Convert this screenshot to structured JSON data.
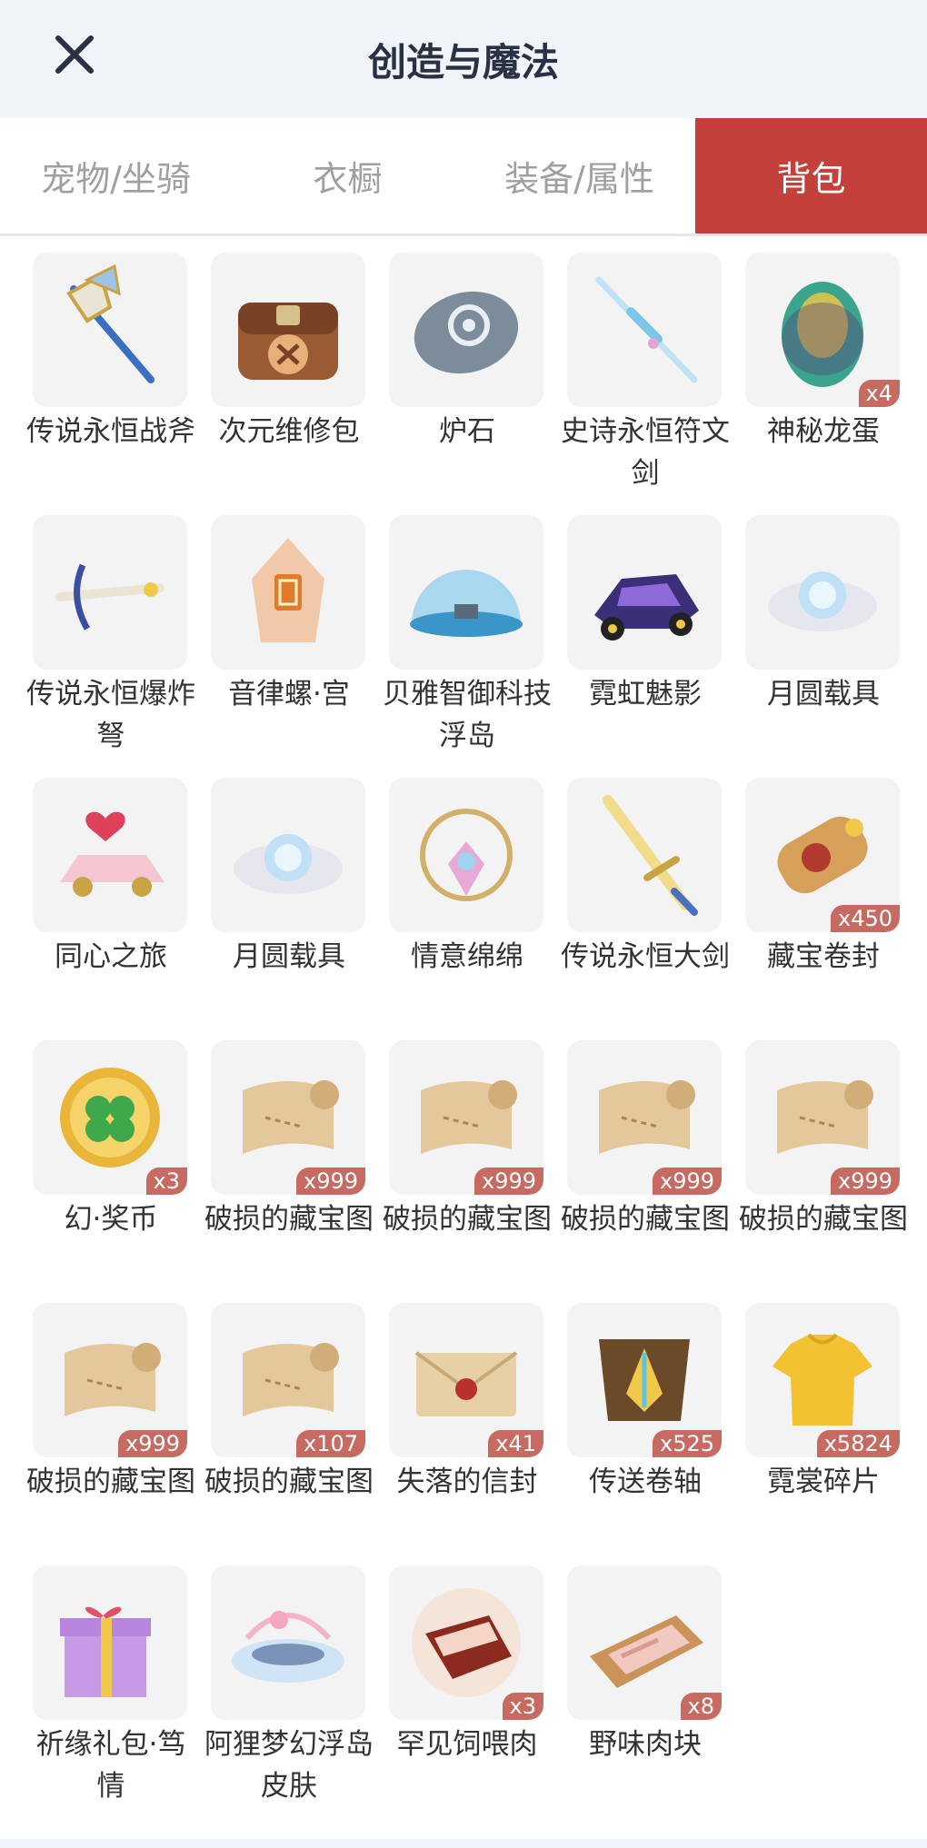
{
  "header": {
    "title": "创造与魔法"
  },
  "tabs": [
    {
      "label": "宠物/坐骑",
      "active": false
    },
    {
      "label": "衣橱",
      "active": false
    },
    {
      "label": "装备/属性",
      "active": false
    },
    {
      "label": "背包",
      "active": true
    }
  ],
  "items": [
    {
      "name": "传说永恒战斧",
      "count": "",
      "icon": "axe-icon"
    },
    {
      "name": "次元维修包",
      "count": "",
      "icon": "repair-bag-icon"
    },
    {
      "name": "炉石",
      "count": "",
      "icon": "hearthstone-icon"
    },
    {
      "name": "史诗永恒符文剑",
      "count": "",
      "icon": "rune-sword-icon"
    },
    {
      "name": "神秘龙蛋",
      "count": "x4",
      "icon": "dragon-egg-icon"
    },
    {
      "name": "传说永恒爆炸弩",
      "count": "",
      "icon": "crossbow-icon"
    },
    {
      "name": "音律螺·宫",
      "count": "",
      "icon": "conch-icon"
    },
    {
      "name": "贝雅智御科技浮岛",
      "count": "",
      "icon": "dome-island-icon"
    },
    {
      "name": "霓虹魅影",
      "count": "",
      "icon": "neon-car-icon"
    },
    {
      "name": "月圆载具",
      "count": "",
      "icon": "moon-cloud-icon"
    },
    {
      "name": "同心之旅",
      "count": "",
      "icon": "heart-car-icon"
    },
    {
      "name": "月圆载具",
      "count": "",
      "icon": "moon-cloud-icon"
    },
    {
      "name": "情意绵绵",
      "count": "",
      "icon": "ornament-icon"
    },
    {
      "name": "传说永恒大剑",
      "count": "",
      "icon": "great-sword-icon"
    },
    {
      "name": "藏宝卷封",
      "count": "x450",
      "icon": "sealed-scroll-icon"
    },
    {
      "name": "幻·奖币",
      "count": "x3",
      "icon": "clover-coin-icon"
    },
    {
      "name": "破损的藏宝图",
      "count": "x999",
      "icon": "treasure-map-icon"
    },
    {
      "name": "破损的藏宝图",
      "count": "x999",
      "icon": "treasure-map-icon"
    },
    {
      "name": "破损的藏宝图",
      "count": "x999",
      "icon": "treasure-map-icon"
    },
    {
      "name": "破损的藏宝图",
      "count": "x999",
      "icon": "treasure-map-icon"
    },
    {
      "name": "破损的藏宝图",
      "count": "x999",
      "icon": "treasure-map-icon"
    },
    {
      "name": "破损的藏宝图",
      "count": "x107",
      "icon": "treasure-map-icon"
    },
    {
      "name": "失落的信封",
      "count": "x41",
      "icon": "envelope-icon"
    },
    {
      "name": "传送卷轴",
      "count": "x525",
      "icon": "teleport-scroll-icon"
    },
    {
      "name": "霓裳碎片",
      "count": "x5824",
      "icon": "shirt-icon"
    },
    {
      "name": "祈缘礼包·笃情",
      "count": "",
      "icon": "gift-box-icon"
    },
    {
      "name": "阿狸梦幻浮岛皮肤",
      "count": "",
      "icon": "cloud-island-icon"
    },
    {
      "name": "罕见饲喂肉",
      "count": "x3",
      "icon": "meat-icon"
    },
    {
      "name": "野味肉块",
      "count": "x8",
      "icon": "meat-tray-icon"
    }
  ]
}
